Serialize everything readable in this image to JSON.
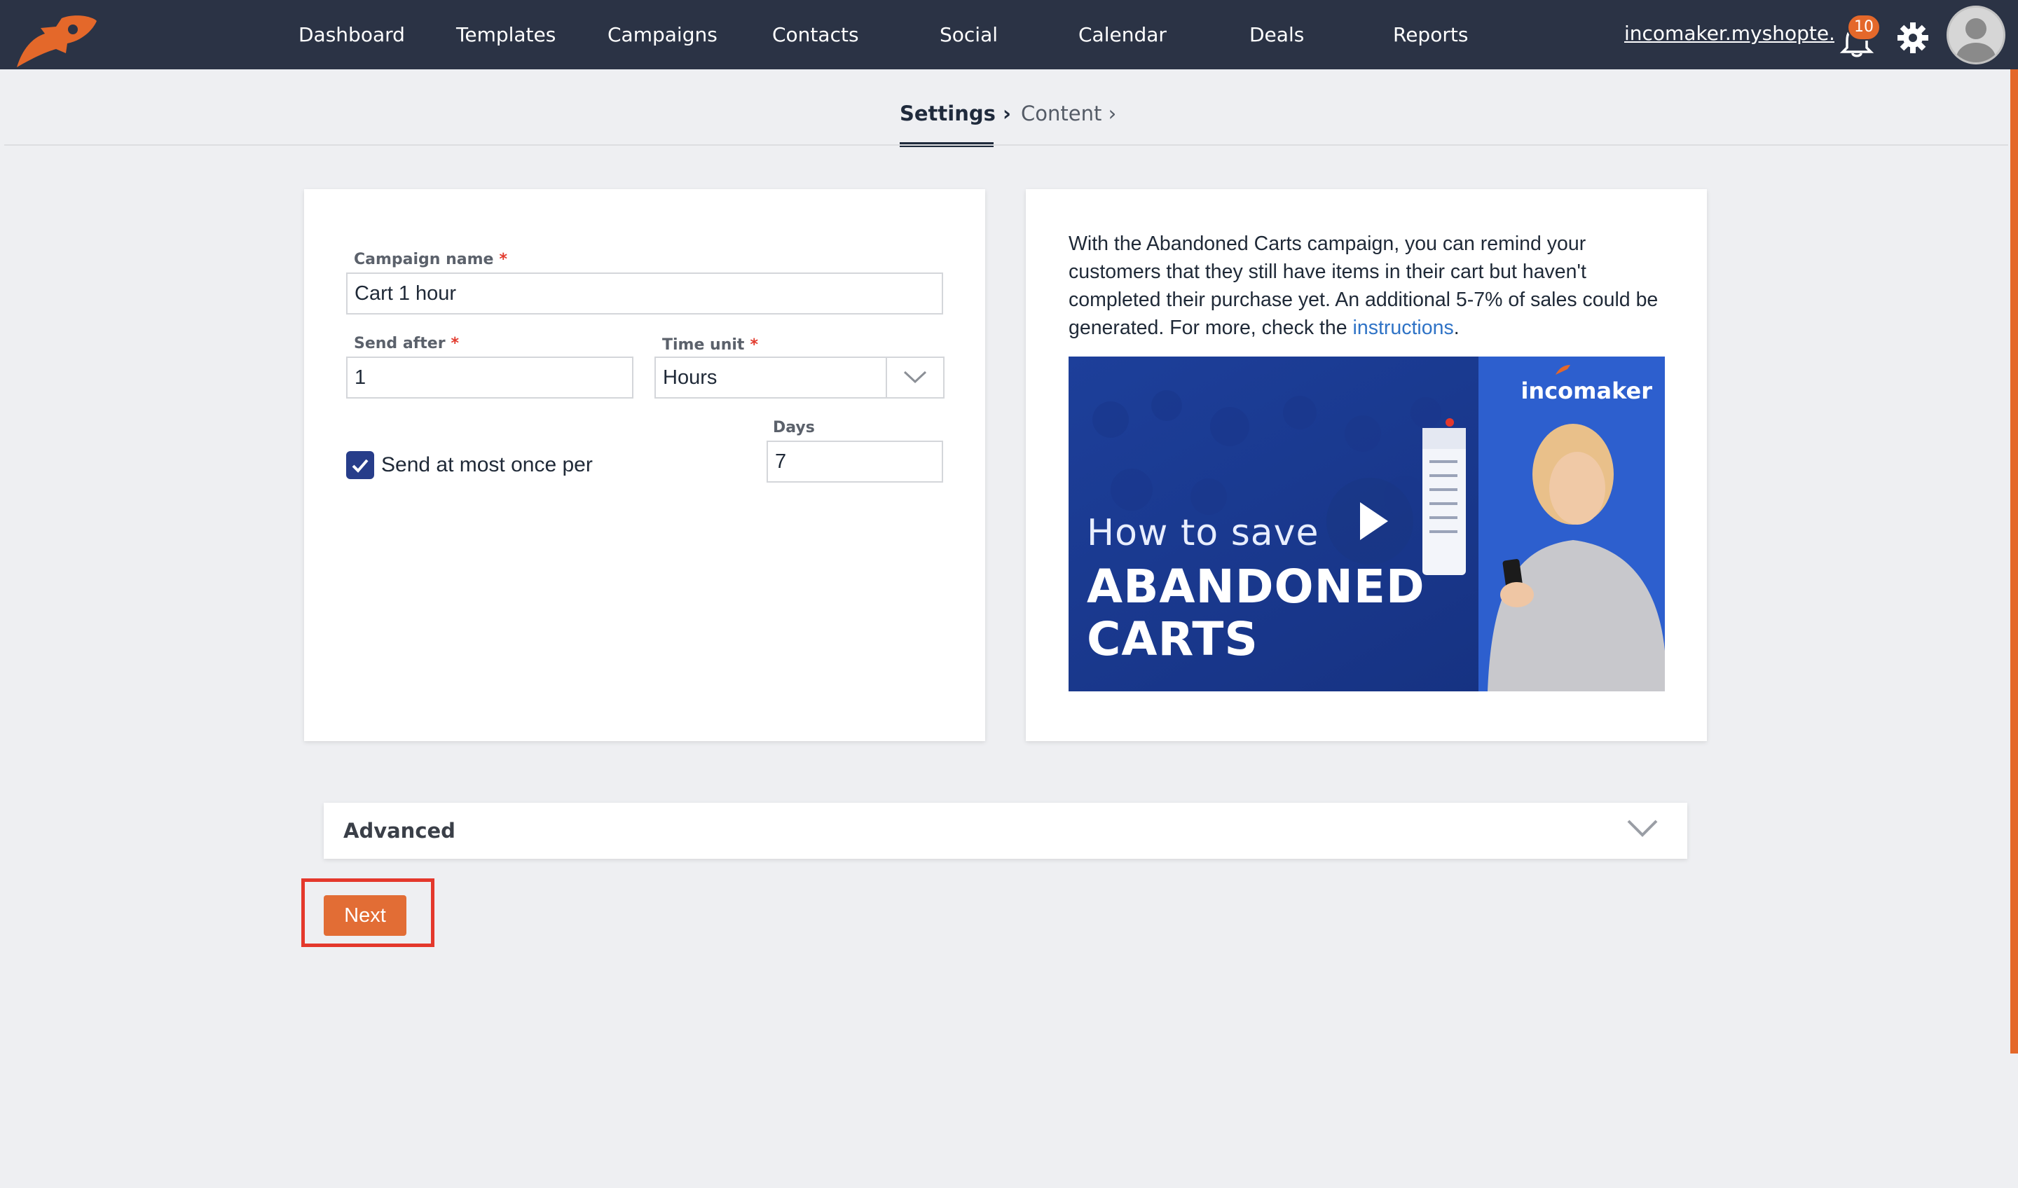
{
  "nav": {
    "items": [
      {
        "label": "Dashboard"
      },
      {
        "label": "Templates"
      },
      {
        "label": "Campaigns"
      },
      {
        "label": "Contacts"
      },
      {
        "label": "Social"
      },
      {
        "label": "Calendar"
      },
      {
        "label": "Deals"
      },
      {
        "label": "Reports"
      }
    ],
    "account": "incomaker.myshopte...",
    "notifications_count": "10",
    "icons": [
      "rocket-logo",
      "bell-icon",
      "gear-icon",
      "avatar"
    ]
  },
  "steps": {
    "settings": "Settings",
    "content": "Content"
  },
  "form": {
    "campaign_name_label": "Campaign name",
    "campaign_name_value": "Cart 1 hour",
    "send_after_label": "Send after",
    "send_after_value": "1",
    "time_unit_label": "Time unit",
    "time_unit_value": "Hours",
    "days_label": "Days",
    "days_value": "7",
    "send_once_label": "Send at most once per",
    "send_once_checked": true,
    "required_mark": "*"
  },
  "info": {
    "text": "With the Abandoned Carts campaign, you can remind your customers that they still have items in their cart but haven't completed their purchase yet. An additional 5-7% of sales could be generated. For more, check the ",
    "link": "instructions",
    "end": "."
  },
  "video": {
    "subtitle": "How to save",
    "title_line1": "ABANDONED",
    "title_line2": "CARTS",
    "brand": "incomaker"
  },
  "advanced": {
    "label": "Advanced"
  },
  "actions": {
    "next_label": "Next"
  },
  "colors": {
    "topbar": "#2b3345",
    "accent": "#e4682a",
    "checkbox": "#273d8a",
    "link": "#2f73c6",
    "highlight": "#e4382c"
  }
}
